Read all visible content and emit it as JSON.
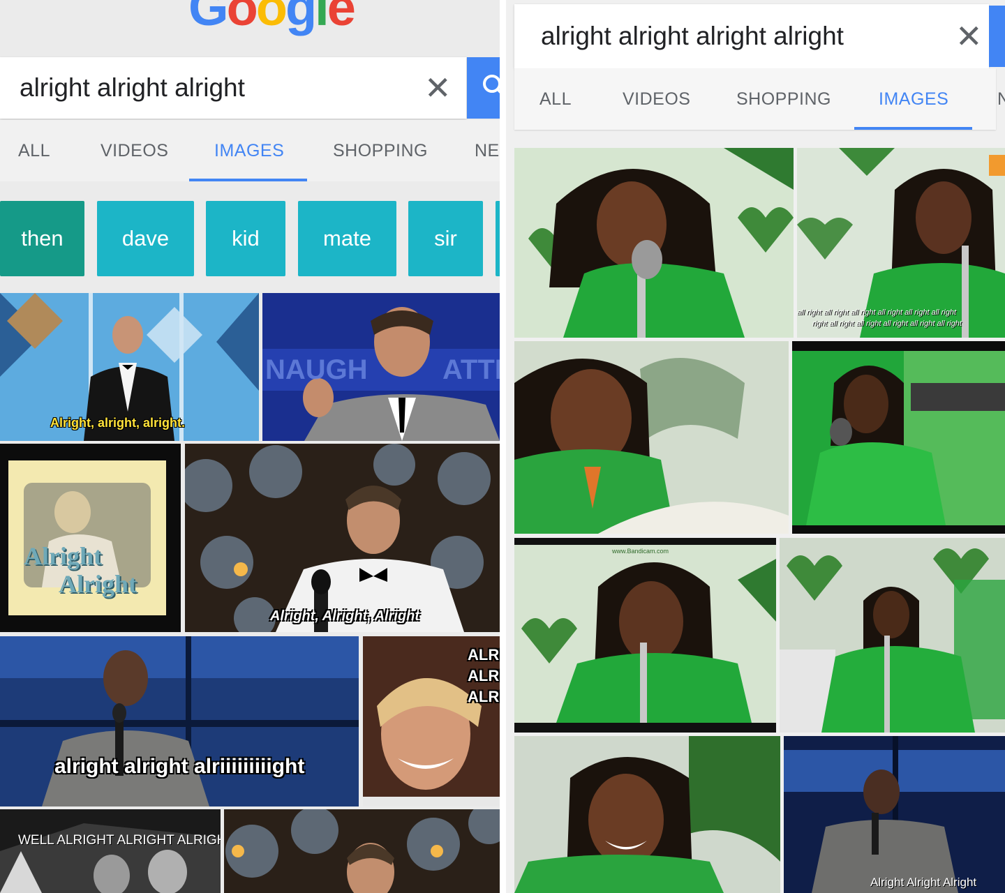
{
  "left": {
    "logo_letters": [
      "G",
      "o",
      "o",
      "g",
      "l",
      "e"
    ],
    "logo_colors": [
      "#4285f4",
      "#ea4335",
      "#fbbc05",
      "#4285f4",
      "#34a853",
      "#ea4335"
    ],
    "search": {
      "query": "alright alright alright"
    },
    "tabs": [
      {
        "label": "ALL",
        "active": false
      },
      {
        "label": "VIDEOS",
        "active": false
      },
      {
        "label": "IMAGES",
        "active": true
      },
      {
        "label": "SHOPPING",
        "active": false
      },
      {
        "label": "NE",
        "active": false
      }
    ],
    "chips": [
      "then",
      "dave",
      "kid",
      "mate",
      "sir"
    ],
    "captions": {
      "tile1": "Alright, alright, alright.",
      "tile2": "NAUGH",
      "tile2b": "ATTH",
      "tile3a": "Alright",
      "tile3b": "Alright",
      "tile4": "Alright, Alright, Alright",
      "tile5": "alright alright alriiiiiiiiight",
      "tile6a": "ALRI",
      "tile6b": "ALRI",
      "tile6c": "ALRI",
      "tile7": "WELL ALRIGHT ALRIGHT ALRIGHT"
    }
  },
  "right": {
    "search": {
      "query": "alright alright alright alright"
    },
    "tabs": [
      {
        "label": "ALL",
        "active": false
      },
      {
        "label": "VIDEOS",
        "active": false
      },
      {
        "label": "SHOPPING",
        "active": false
      },
      {
        "label": "IMAGES",
        "active": true
      },
      {
        "label": "N",
        "active": false
      }
    ],
    "captions": {
      "tile2a": "all right all right all right all right all right all right",
      "tile2b": "right all right all right all right all right all right",
      "tile5": "www.Bandicam.com",
      "tile8": "Alright Alright Alright"
    }
  },
  "colors": {
    "accent_blue": "#4285f4",
    "chip_teal": "#1cb5c7",
    "chip_dark_teal": "#159a88"
  },
  "icons": {
    "clear": "close-icon",
    "search": "search-icon"
  }
}
